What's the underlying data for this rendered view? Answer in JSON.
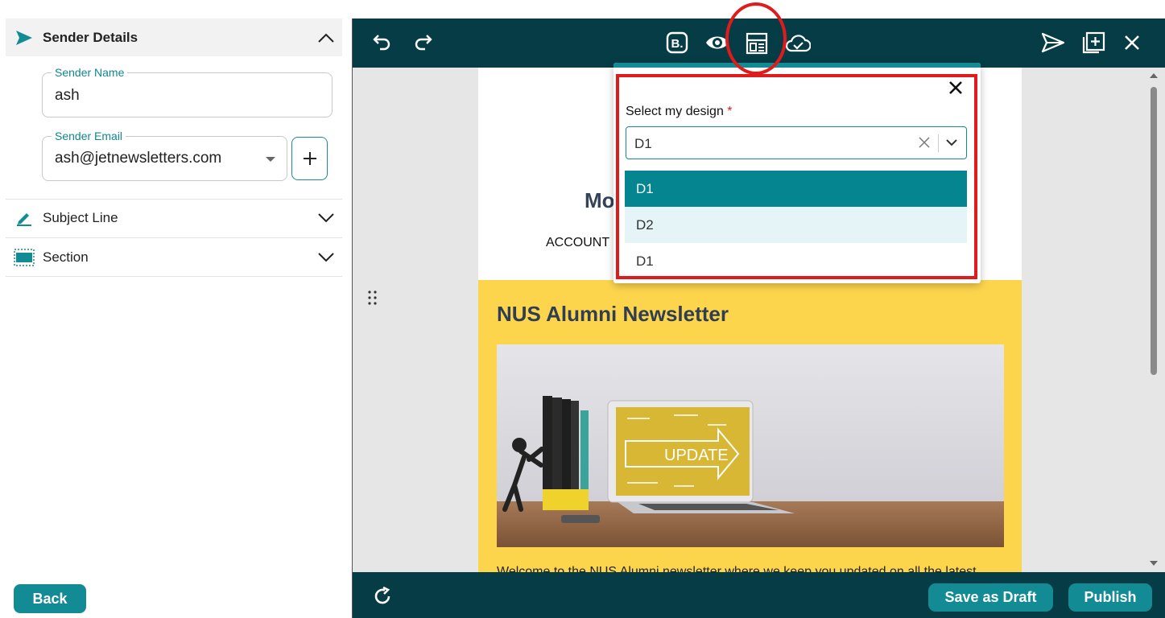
{
  "sidebar": {
    "sender_details": {
      "title": "Sender Details"
    },
    "sender_name": {
      "label": "Sender Name",
      "value": "ash"
    },
    "sender_email": {
      "label": "Sender Email",
      "value": "ash@jetnewsletters.com"
    },
    "subject_line": {
      "title": "Subject Line"
    },
    "section": {
      "title": "Section"
    },
    "back_label": "Back"
  },
  "toolbar": {
    "icons": [
      "undo-icon",
      "redo-icon",
      "brand-icon",
      "preview-eye-icon",
      "design-layout-icon",
      "cloud-save-icon",
      "send-icon",
      "add-block-icon",
      "close-icon"
    ]
  },
  "email_preview": {
    "heading_partial": "Mo",
    "account_partial": "ACCOUNT",
    "newsletter_title": "NUS Alumni Newsletter",
    "image_text": "UPDATE",
    "intro_text": "Welcome to the NUS Alumni newsletter where we keep you updated on all the latest"
  },
  "design_popup": {
    "label": "Select my design",
    "required_mark": "*",
    "selected_value": "D1",
    "options": [
      {
        "label": "D1",
        "state": "selected"
      },
      {
        "label": "D2",
        "state": "hover"
      },
      {
        "label": "D1",
        "state": "normal"
      }
    ]
  },
  "footer": {
    "save_draft_label": "Save as Draft",
    "publish_label": "Publish"
  },
  "colors": {
    "brand_teal": "#138b95",
    "toolbar_dark": "#053c45",
    "newsletter_yellow": "#fdd54d",
    "annotation_red": "#e01b1b"
  }
}
